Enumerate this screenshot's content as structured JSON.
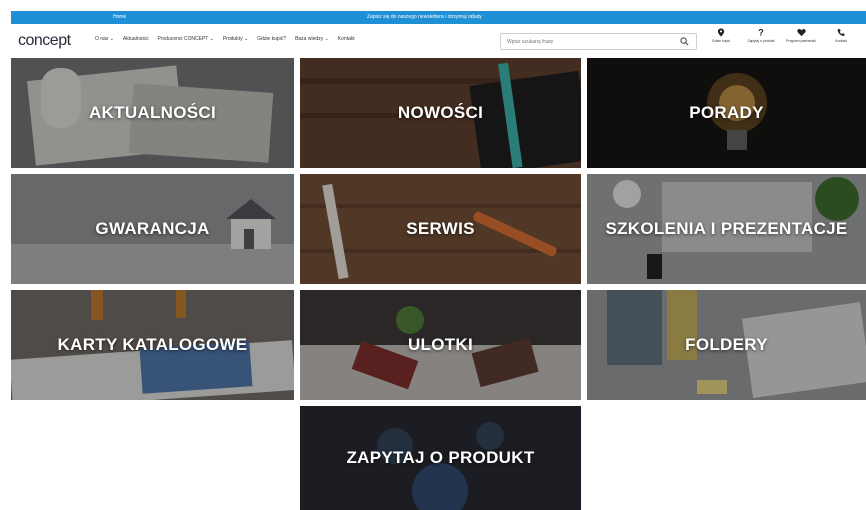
{
  "topbar": {
    "left_text": "Home",
    "center_text": "Zapisz się do naszego newslettera i otrzymuj rabaty"
  },
  "header": {
    "logo_text": "concept",
    "menu": [
      {
        "label": "O nas ⌄"
      },
      {
        "label": "Aktualności"
      },
      {
        "label": "Producenci CONCEPT ⌄"
      },
      {
        "label": "Produkty ⌄"
      },
      {
        "label": "Gdzie kupić?"
      },
      {
        "label": "Baza wiedzy ⌄"
      },
      {
        "label": "Kontakt"
      }
    ],
    "search": {
      "placeholder": "Wpisz szukaną frazę"
    },
    "quick_links": [
      {
        "label": "Gdzie kupić",
        "icon": "map-pin-icon"
      },
      {
        "label": "Zapytaj o produkt",
        "icon": "question-icon"
      },
      {
        "label": "Program partnerski",
        "icon": "heart-icon"
      },
      {
        "label": "Kontakt",
        "icon": "phone-icon"
      }
    ]
  },
  "tiles": [
    {
      "label": "AKTUALNOŚCI",
      "bg": "#7d7f80"
    },
    {
      "label": "NOWOŚCI",
      "bg": "#4a3328"
    },
    {
      "label": "PORADY",
      "bg": "#1e1a14"
    },
    {
      "label": "GWARANCJA",
      "bg": "#8a8a8c"
    },
    {
      "label": "SERWIS",
      "bg": "#5a3e2c"
    },
    {
      "label": "SZKOLENIA I PREZENTACJE",
      "bg": "#8e9090"
    },
    {
      "label": "KARTY KATALOGOWE",
      "bg": "#6f6a66"
    },
    {
      "label": "ULOTKI",
      "bg": "#403b38"
    },
    {
      "label": "FOLDERY",
      "bg": "#8b8c8d"
    },
    {
      "label": "ZAPYTAJ O PRODUKT",
      "bg": "#2b2d32"
    }
  ],
  "colors": {
    "accent": "#1f8fd6"
  }
}
